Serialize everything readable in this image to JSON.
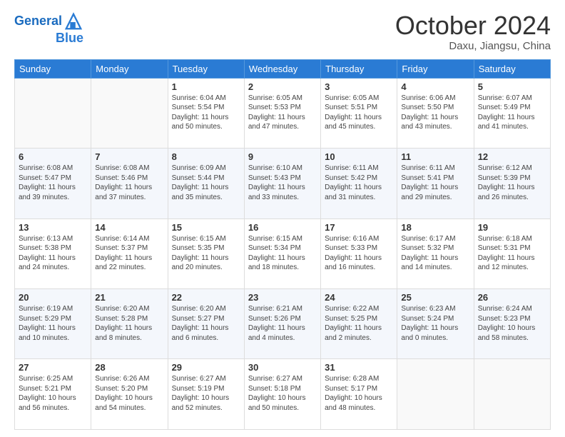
{
  "header": {
    "logo_line1": "General",
    "logo_line2": "Blue",
    "month": "October 2024",
    "location": "Daxu, Jiangsu, China"
  },
  "weekdays": [
    "Sunday",
    "Monday",
    "Tuesday",
    "Wednesday",
    "Thursday",
    "Friday",
    "Saturday"
  ],
  "weeks": [
    [
      {
        "day": "",
        "info": ""
      },
      {
        "day": "",
        "info": ""
      },
      {
        "day": "1",
        "info": "Sunrise: 6:04 AM\nSunset: 5:54 PM\nDaylight: 11 hours and 50 minutes."
      },
      {
        "day": "2",
        "info": "Sunrise: 6:05 AM\nSunset: 5:53 PM\nDaylight: 11 hours and 47 minutes."
      },
      {
        "day": "3",
        "info": "Sunrise: 6:05 AM\nSunset: 5:51 PM\nDaylight: 11 hours and 45 minutes."
      },
      {
        "day": "4",
        "info": "Sunrise: 6:06 AM\nSunset: 5:50 PM\nDaylight: 11 hours and 43 minutes."
      },
      {
        "day": "5",
        "info": "Sunrise: 6:07 AM\nSunset: 5:49 PM\nDaylight: 11 hours and 41 minutes."
      }
    ],
    [
      {
        "day": "6",
        "info": "Sunrise: 6:08 AM\nSunset: 5:47 PM\nDaylight: 11 hours and 39 minutes."
      },
      {
        "day": "7",
        "info": "Sunrise: 6:08 AM\nSunset: 5:46 PM\nDaylight: 11 hours and 37 minutes."
      },
      {
        "day": "8",
        "info": "Sunrise: 6:09 AM\nSunset: 5:44 PM\nDaylight: 11 hours and 35 minutes."
      },
      {
        "day": "9",
        "info": "Sunrise: 6:10 AM\nSunset: 5:43 PM\nDaylight: 11 hours and 33 minutes."
      },
      {
        "day": "10",
        "info": "Sunrise: 6:11 AM\nSunset: 5:42 PM\nDaylight: 11 hours and 31 minutes."
      },
      {
        "day": "11",
        "info": "Sunrise: 6:11 AM\nSunset: 5:41 PM\nDaylight: 11 hours and 29 minutes."
      },
      {
        "day": "12",
        "info": "Sunrise: 6:12 AM\nSunset: 5:39 PM\nDaylight: 11 hours and 26 minutes."
      }
    ],
    [
      {
        "day": "13",
        "info": "Sunrise: 6:13 AM\nSunset: 5:38 PM\nDaylight: 11 hours and 24 minutes."
      },
      {
        "day": "14",
        "info": "Sunrise: 6:14 AM\nSunset: 5:37 PM\nDaylight: 11 hours and 22 minutes."
      },
      {
        "day": "15",
        "info": "Sunrise: 6:15 AM\nSunset: 5:35 PM\nDaylight: 11 hours and 20 minutes."
      },
      {
        "day": "16",
        "info": "Sunrise: 6:15 AM\nSunset: 5:34 PM\nDaylight: 11 hours and 18 minutes."
      },
      {
        "day": "17",
        "info": "Sunrise: 6:16 AM\nSunset: 5:33 PM\nDaylight: 11 hours and 16 minutes."
      },
      {
        "day": "18",
        "info": "Sunrise: 6:17 AM\nSunset: 5:32 PM\nDaylight: 11 hours and 14 minutes."
      },
      {
        "day": "19",
        "info": "Sunrise: 6:18 AM\nSunset: 5:31 PM\nDaylight: 11 hours and 12 minutes."
      }
    ],
    [
      {
        "day": "20",
        "info": "Sunrise: 6:19 AM\nSunset: 5:29 PM\nDaylight: 11 hours and 10 minutes."
      },
      {
        "day": "21",
        "info": "Sunrise: 6:20 AM\nSunset: 5:28 PM\nDaylight: 11 hours and 8 minutes."
      },
      {
        "day": "22",
        "info": "Sunrise: 6:20 AM\nSunset: 5:27 PM\nDaylight: 11 hours and 6 minutes."
      },
      {
        "day": "23",
        "info": "Sunrise: 6:21 AM\nSunset: 5:26 PM\nDaylight: 11 hours and 4 minutes."
      },
      {
        "day": "24",
        "info": "Sunrise: 6:22 AM\nSunset: 5:25 PM\nDaylight: 11 hours and 2 minutes."
      },
      {
        "day": "25",
        "info": "Sunrise: 6:23 AM\nSunset: 5:24 PM\nDaylight: 11 hours and 0 minutes."
      },
      {
        "day": "26",
        "info": "Sunrise: 6:24 AM\nSunset: 5:23 PM\nDaylight: 10 hours and 58 minutes."
      }
    ],
    [
      {
        "day": "27",
        "info": "Sunrise: 6:25 AM\nSunset: 5:21 PM\nDaylight: 10 hours and 56 minutes."
      },
      {
        "day": "28",
        "info": "Sunrise: 6:26 AM\nSunset: 5:20 PM\nDaylight: 10 hours and 54 minutes."
      },
      {
        "day": "29",
        "info": "Sunrise: 6:27 AM\nSunset: 5:19 PM\nDaylight: 10 hours and 52 minutes."
      },
      {
        "day": "30",
        "info": "Sunrise: 6:27 AM\nSunset: 5:18 PM\nDaylight: 10 hours and 50 minutes."
      },
      {
        "day": "31",
        "info": "Sunrise: 6:28 AM\nSunset: 5:17 PM\nDaylight: 10 hours and 48 minutes."
      },
      {
        "day": "",
        "info": ""
      },
      {
        "day": "",
        "info": ""
      }
    ]
  ]
}
